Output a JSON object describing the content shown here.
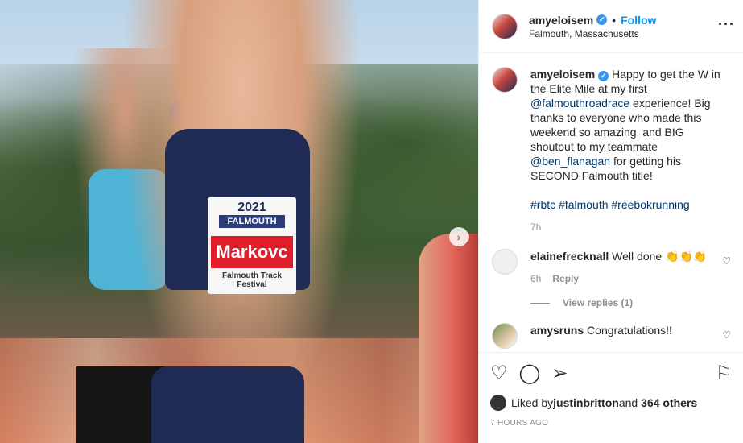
{
  "post": {
    "username": "amyeloisem",
    "follow_label": "Follow",
    "dot": "•",
    "location": "Falmouth, Massachusetts",
    "more": "···",
    "photo": {
      "bib_year": "2021",
      "bib_tag": "FALMOUTH",
      "bib_name": "Markovc",
      "bib_footer": "Falmouth Track Festival"
    }
  },
  "caption": {
    "username": "amyeloisem",
    "text_1": " Happy to get the W in the Elite Mile at my first ",
    "mention_1": "@falmouthroadrace",
    "text_2": " experience! Big thanks to everyone who made this weekend so amazing, and BIG shoutout to my teammate ",
    "mention_2": "@ben_flanagan",
    "text_3": " for getting his SECOND Falmouth title!",
    "tag_1": "#rbtc",
    "tag_2": "#falmouth",
    "tag_3": "#reebokrunning",
    "age": "7h"
  },
  "comments": [
    {
      "username": "elainefrecknall",
      "text": "Well done 👏👏👏",
      "age": "6h",
      "reply_label": "Reply"
    },
    {
      "username": "amysruns",
      "text": "Congratulations!!"
    }
  ],
  "view_replies": "View replies (1)",
  "likes": {
    "prefix": "Liked by ",
    "user": "justinbritton",
    "middle": " and ",
    "count": "364 others"
  },
  "timestamp": "7 HOURS AGO",
  "icons": {
    "like": "heart-icon",
    "comment": "comment-icon",
    "share": "share-icon",
    "save": "bookmark-icon",
    "verified": "verified-badge-icon"
  }
}
